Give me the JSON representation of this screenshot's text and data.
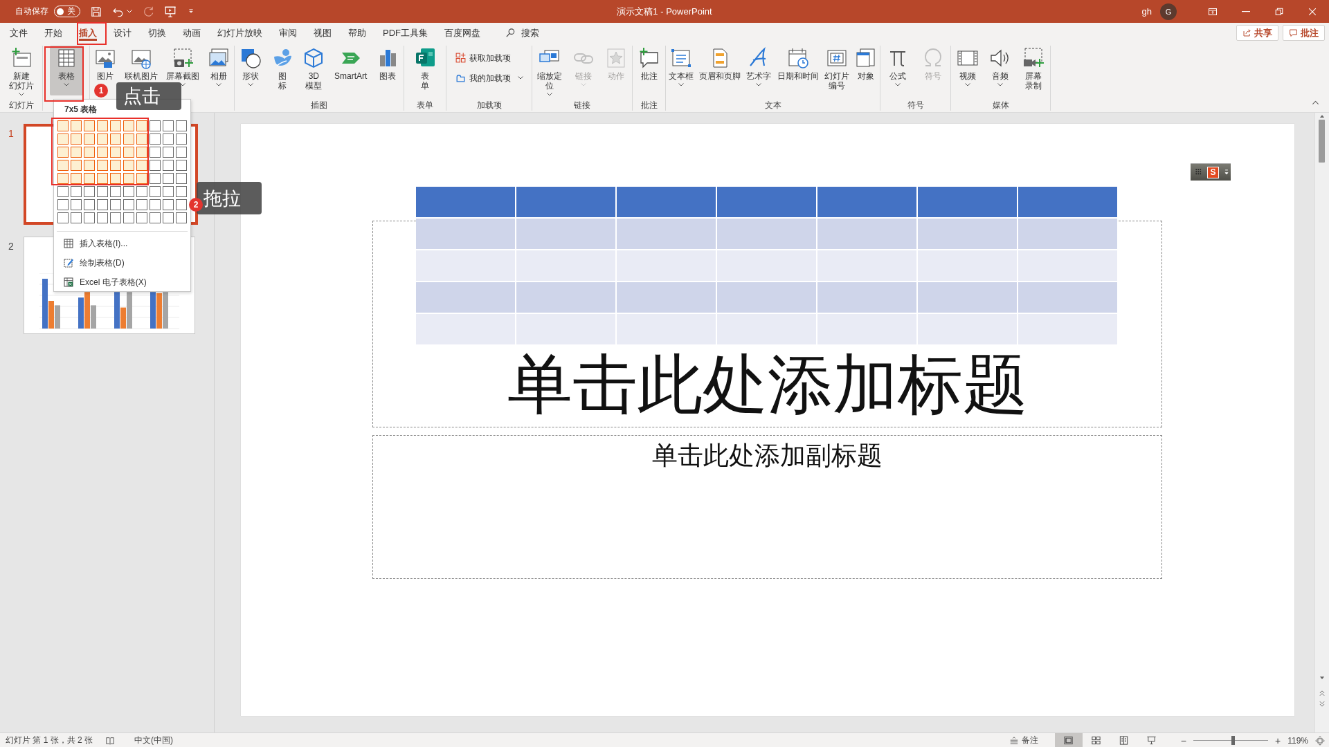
{
  "title_bar": {
    "autosave_label": "自动保存",
    "autosave_toggle": {
      "text": "关",
      "on": false
    },
    "document_title": "演示文稿1 - PowerPoint",
    "user_name": "gh",
    "avatar_initial": "G"
  },
  "ribbon_tabs": [
    {
      "label": "文件",
      "selected": false
    },
    {
      "label": "开始",
      "selected": false
    },
    {
      "label": "插入",
      "selected": true
    },
    {
      "label": "设计",
      "selected": false
    },
    {
      "label": "切换",
      "selected": false
    },
    {
      "label": "动画",
      "selected": false
    },
    {
      "label": "幻灯片放映",
      "selected": false
    },
    {
      "label": "审阅",
      "selected": false
    },
    {
      "label": "视图",
      "selected": false
    },
    {
      "label": "帮助",
      "selected": false
    },
    {
      "label": "PDF工具集",
      "selected": false
    },
    {
      "label": "百度网盘",
      "selected": false
    }
  ],
  "search": {
    "label": "搜索"
  },
  "share_button": "共享",
  "comments_button": "批注",
  "ribbon_groups": [
    {
      "label": "幻灯片",
      "buttons": [
        {
          "kind": "large",
          "label": "新建幻灯片",
          "dropdown": true,
          "pressed": false,
          "disabled": false
        }
      ]
    },
    {
      "buttons": [
        {
          "kind": "large",
          "label": "表格",
          "dropdown": true,
          "pressed": true,
          "disabled": false
        }
      ]
    },
    {
      "buttons": [
        {
          "kind": "large",
          "label": "图片",
          "dropdown": false,
          "pressed": false,
          "disabled": false
        },
        {
          "kind": "large",
          "label": "联机图片",
          "dropdown": false,
          "pressed": false,
          "disabled": false
        },
        {
          "kind": "large",
          "label": "屏幕截图",
          "dropdown": true,
          "pressed": false,
          "disabled": false
        },
        {
          "kind": "large",
          "label": "相册",
          "dropdown": true,
          "pressed": false,
          "disabled": false
        }
      ]
    },
    {
      "label": "插图",
      "buttons": [
        {
          "kind": "large",
          "label": "形状",
          "dropdown": true,
          "pressed": false,
          "disabled": false
        },
        {
          "kind": "large",
          "label": "图标",
          "dropdown": false,
          "pressed": false,
          "disabled": false
        },
        {
          "kind": "large",
          "label": "3D模型",
          "dropdown": false,
          "pressed": false,
          "disabled": false
        },
        {
          "kind": "large",
          "label": "SmartArt",
          "dropdown": false,
          "pressed": false,
          "disabled": false
        },
        {
          "kind": "large",
          "label": "图表",
          "dropdown": false,
          "pressed": false,
          "disabled": false
        }
      ]
    },
    {
      "label": "表单",
      "buttons": [
        {
          "kind": "large",
          "label": "表单",
          "dropdown": false,
          "pressed": false,
          "disabled": false
        }
      ]
    },
    {
      "label": "加载项",
      "buttons": [
        {
          "kind": "small",
          "label": "获取加载项",
          "dropdown": false,
          "pressed": false,
          "disabled": false
        },
        {
          "kind": "small",
          "label": "我的加载项",
          "dropdown": true,
          "pressed": false,
          "disabled": false
        }
      ]
    },
    {
      "label": "链接",
      "buttons": [
        {
          "kind": "large",
          "label": "缩放定位",
          "dropdown": true,
          "pressed": false,
          "disabled": false
        },
        {
          "kind": "large",
          "label": "链接",
          "dropdown": true,
          "pressed": false,
          "disabled": true
        },
        {
          "kind": "large",
          "label": "动作",
          "dropdown": false,
          "pressed": false,
          "disabled": true
        }
      ]
    },
    {
      "label": "批注",
      "buttons": [
        {
          "kind": "large",
          "label": "批注",
          "dropdown": false,
          "pressed": false,
          "disabled": false
        }
      ]
    },
    {
      "label": "文本",
      "buttons": [
        {
          "kind": "large",
          "label": "文本框",
          "dropdown": true,
          "pressed": false,
          "disabled": false
        },
        {
          "kind": "large",
          "label": "页眉和页脚",
          "dropdown": false,
          "pressed": false,
          "disabled": false
        },
        {
          "kind": "large",
          "label": "艺术字",
          "dropdown": true,
          "pressed": false,
          "disabled": false
        },
        {
          "kind": "large",
          "label": "日期和时间",
          "dropdown": false,
          "pressed": false,
          "disabled": false
        },
        {
          "kind": "large",
          "label": "幻灯片编号",
          "dropdown": false,
          "pressed": false,
          "disabled": false
        },
        {
          "kind": "large",
          "label": "对象",
          "dropdown": false,
          "pressed": false,
          "disabled": false
        }
      ]
    },
    {
      "label": "符号",
      "buttons": [
        {
          "kind": "large",
          "label": "公式",
          "dropdown": true,
          "pressed": false,
          "disabled": false
        },
        {
          "kind": "large",
          "label": "符号",
          "dropdown": false,
          "pressed": false,
          "disabled": true
        }
      ]
    },
    {
      "label": "媒体",
      "buttons": [
        {
          "kind": "large",
          "label": "视频",
          "dropdown": true,
          "pressed": false,
          "disabled": false
        },
        {
          "kind": "large",
          "label": "音频",
          "dropdown": true,
          "pressed": false,
          "disabled": false
        },
        {
          "kind": "large",
          "label": "屏幕录制",
          "dropdown": false,
          "pressed": false,
          "disabled": false
        }
      ]
    }
  ],
  "table_dropdown": {
    "header": "7x5 表格",
    "grid_rows": [
      {
        "cells": [
          {
            "selected": true
          },
          {
            "selected": true
          },
          {
            "selected": true
          },
          {
            "selected": true
          },
          {
            "selected": true
          },
          {
            "selected": true
          },
          {
            "selected": true
          },
          {
            "selected": false
          },
          {
            "selected": false
          },
          {
            "selected": false
          }
        ]
      },
      {
        "cells": [
          {
            "selected": true
          },
          {
            "selected": true
          },
          {
            "selected": true
          },
          {
            "selected": true
          },
          {
            "selected": true
          },
          {
            "selected": true
          },
          {
            "selected": true
          },
          {
            "selected": false
          },
          {
            "selected": false
          },
          {
            "selected": false
          }
        ]
      },
      {
        "cells": [
          {
            "selected": true
          },
          {
            "selected": true
          },
          {
            "selected": true
          },
          {
            "selected": true
          },
          {
            "selected": true
          },
          {
            "selected": true
          },
          {
            "selected": true
          },
          {
            "selected": false
          },
          {
            "selected": false
          },
          {
            "selected": false
          }
        ]
      },
      {
        "cells": [
          {
            "selected": true
          },
          {
            "selected": true
          },
          {
            "selected": true
          },
          {
            "selected": true
          },
          {
            "selected": true
          },
          {
            "selected": true
          },
          {
            "selected": true
          },
          {
            "selected": false
          },
          {
            "selected": false
          },
          {
            "selected": false
          }
        ]
      },
      {
        "cells": [
          {
            "selected": true
          },
          {
            "selected": true
          },
          {
            "selected": true
          },
          {
            "selected": true
          },
          {
            "selected": true
          },
          {
            "selected": true
          },
          {
            "selected": true
          },
          {
            "selected": false
          },
          {
            "selected": false
          },
          {
            "selected": false
          }
        ]
      },
      {
        "cells": [
          {
            "selected": false
          },
          {
            "selected": false
          },
          {
            "selected": false
          },
          {
            "selected": false
          },
          {
            "selected": false
          },
          {
            "selected": false
          },
          {
            "selected": false
          },
          {
            "selected": false
          },
          {
            "selected": false
          },
          {
            "selected": false
          }
        ]
      },
      {
        "cells": [
          {
            "selected": false
          },
          {
            "selected": false
          },
          {
            "selected": false
          },
          {
            "selected": false
          },
          {
            "selected": false
          },
          {
            "selected": false
          },
          {
            "selected": false
          },
          {
            "selected": false
          },
          {
            "selected": false
          },
          {
            "selected": false
          }
        ]
      },
      {
        "cells": [
          {
            "selected": false
          },
          {
            "selected": false
          },
          {
            "selected": false
          },
          {
            "selected": false
          },
          {
            "selected": false
          },
          {
            "selected": false
          },
          {
            "selected": false
          },
          {
            "selected": false
          },
          {
            "selected": false
          },
          {
            "selected": false
          }
        ]
      }
    ],
    "menu_items": [
      "插入表格(I)...",
      "绘制表格(D)",
      "Excel 电子表格(X)"
    ]
  },
  "annotations": [
    {
      "kind": "click",
      "badge": "1",
      "text": "点击"
    },
    {
      "kind": "drag",
      "badge": "2",
      "text": "拖拉"
    }
  ],
  "slides": [
    {
      "number": "1",
      "selected": true,
      "kind": "title"
    },
    {
      "number": "2",
      "selected": false,
      "kind": "chart"
    }
  ],
  "slide": {
    "table_rows": [
      {
        "kind": "header",
        "cells": [
          {},
          {},
          {},
          {},
          {},
          {},
          {}
        ]
      },
      {
        "kind": "band",
        "cells": [
          {},
          {},
          {},
          {},
          {},
          {},
          {}
        ]
      },
      {
        "kind": "plain",
        "cells": [
          {},
          {},
          {},
          {},
          {},
          {},
          {}
        ]
      },
      {
        "kind": "band",
        "cells": [
          {},
          {},
          {},
          {},
          {},
          {},
          {}
        ]
      },
      {
        "kind": "plain",
        "cells": [
          {},
          {},
          {},
          {},
          {},
          {},
          {}
        ]
      }
    ],
    "title_placeholder": "单击此处添加标题",
    "subtitle_placeholder": "单击此处添加副标题"
  },
  "ime_toolbar": {
    "badge": "S"
  },
  "status_bar": {
    "slide_info": "幻灯片 第 1 张，共 2 张",
    "language": "中文(中国)",
    "notes_button": "备注",
    "views": [
      {
        "selected": true
      },
      {
        "selected": false
      },
      {
        "selected": false
      },
      {
        "selected": false
      }
    ],
    "zoom_out": "−",
    "zoom_in": "+",
    "zoom": {
      "level": 0.53
    },
    "zoom_percent": "119%"
  }
}
